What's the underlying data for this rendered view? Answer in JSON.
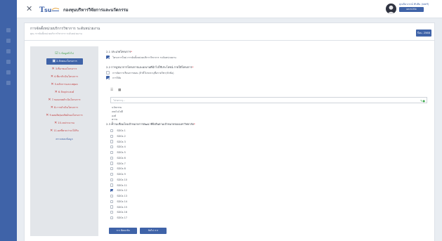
{
  "header": {
    "close_icon": "close-icon",
    "org_name": "กองทุนบริหารวิจัยการและนวัตกรรม",
    "user_name": "คุณปิยาภรณ์ ทับทิม (staff)",
    "role_label": "ผลงานวิจัย"
  },
  "page": {
    "title": "การจัดตั้งหน่วยบริการวิชาการ ระดับหน่วยงาน",
    "subtitle": "คุณ การจัดตั้งหน่วยบริการวิชาการ ระดับหน่วยงาน",
    "year_label": "ปีงบ. 2568"
  },
  "steps": [
    {
      "label": "1.ข้อมูลทั่วไป",
      "status": "done"
    },
    {
      "label": "2.ลักษณะโครงการ",
      "status": "active"
    },
    {
      "label": "3.ที่มาของโครงการ",
      "status": "todo"
    },
    {
      "label": "4.ที่มาตัวเงินโครงการ",
      "status": "todo"
    },
    {
      "label": "5.หลักการและเหตุผล",
      "status": "todo"
    },
    {
      "label": "6.วัตถุประสงค์",
      "status": "todo"
    },
    {
      "label": "7.ขอบเขตดำเนินโครงการ",
      "status": "todo"
    },
    {
      "label": "8.การดำเนินโครงการ",
      "status": "todo"
    },
    {
      "label": "9.ผลผลิต/ผลลัพธ์ของโครงการ",
      "status": "todo"
    },
    {
      "label": "10.งบประมาณ",
      "status": "todo"
    },
    {
      "label": "11.ผลที่คาดว่าจะได้รับ",
      "status": "todo"
    },
    {
      "label": "ตรวจสอบข้อมูล",
      "status": "plain"
    }
  ],
  "form": {
    "section1_label": "2.1 ประเภทโครงการ",
    "section1_option": "โครงการใหม่ การจัดตั้งหน่วยบริการวิชาการ ระดับหน่วยงาน",
    "section2_label": "2.2 การบูรณาการโครงการและผลงานที่นำไปใช้ประโยชน์ ภายใต้โครงการ",
    "section2_options": [
      {
        "label": "การจัดการเรียนการสอน (ถ้ามีโปรดระบุชื่อรายวิชา/หัวข้อ)",
        "checked": false
      },
      {
        "label": "การวิจัย",
        "checked": true
      }
    ],
    "toolbar": [
      "list-icon",
      "image-icon"
    ],
    "text_placeholder": "โปรดระบุ...",
    "sub_options": [
      "นวัตกรรม",
      "เทคโนโลยี",
      "องค์ความรู้"
    ],
    "section3_label": "2.3 ความเชื่อมโยงเป้าหมายการพัฒนาที่ยั่งยืนตามเป้าหมายของมหาวิทยาลัย",
    "sdgs": [
      {
        "label": "SDGs 1",
        "checked": false
      },
      {
        "label": "SDGs 2",
        "checked": false
      },
      {
        "label": "SDGs 3",
        "checked": false
      },
      {
        "label": "SDGs 4",
        "checked": false
      },
      {
        "label": "SDGs 5",
        "checked": false
      },
      {
        "label": "SDGs 6",
        "checked": false
      },
      {
        "label": "SDGs 7",
        "checked": false
      },
      {
        "label": "SDGs 8",
        "checked": false
      },
      {
        "label": "SDGs 9",
        "checked": false
      },
      {
        "label": "SDGs 10",
        "checked": false
      },
      {
        "label": "SDGs 11",
        "checked": false
      },
      {
        "label": "SDGs 12",
        "checked": true
      },
      {
        "label": "SDGs 13",
        "checked": false
      },
      {
        "label": "SDGs 14",
        "checked": false
      },
      {
        "label": "SDGs 15",
        "checked": false
      },
      {
        "label": "SDGs 16",
        "checked": false
      },
      {
        "label": "SDGs 17",
        "checked": false
      }
    ],
    "back_label": "<< ย้อนกลับ",
    "next_label": "ถัดไป >>"
  },
  "colors": {
    "primary": "#3f63a8",
    "done": "#44a04a",
    "todo": "#c24040"
  }
}
